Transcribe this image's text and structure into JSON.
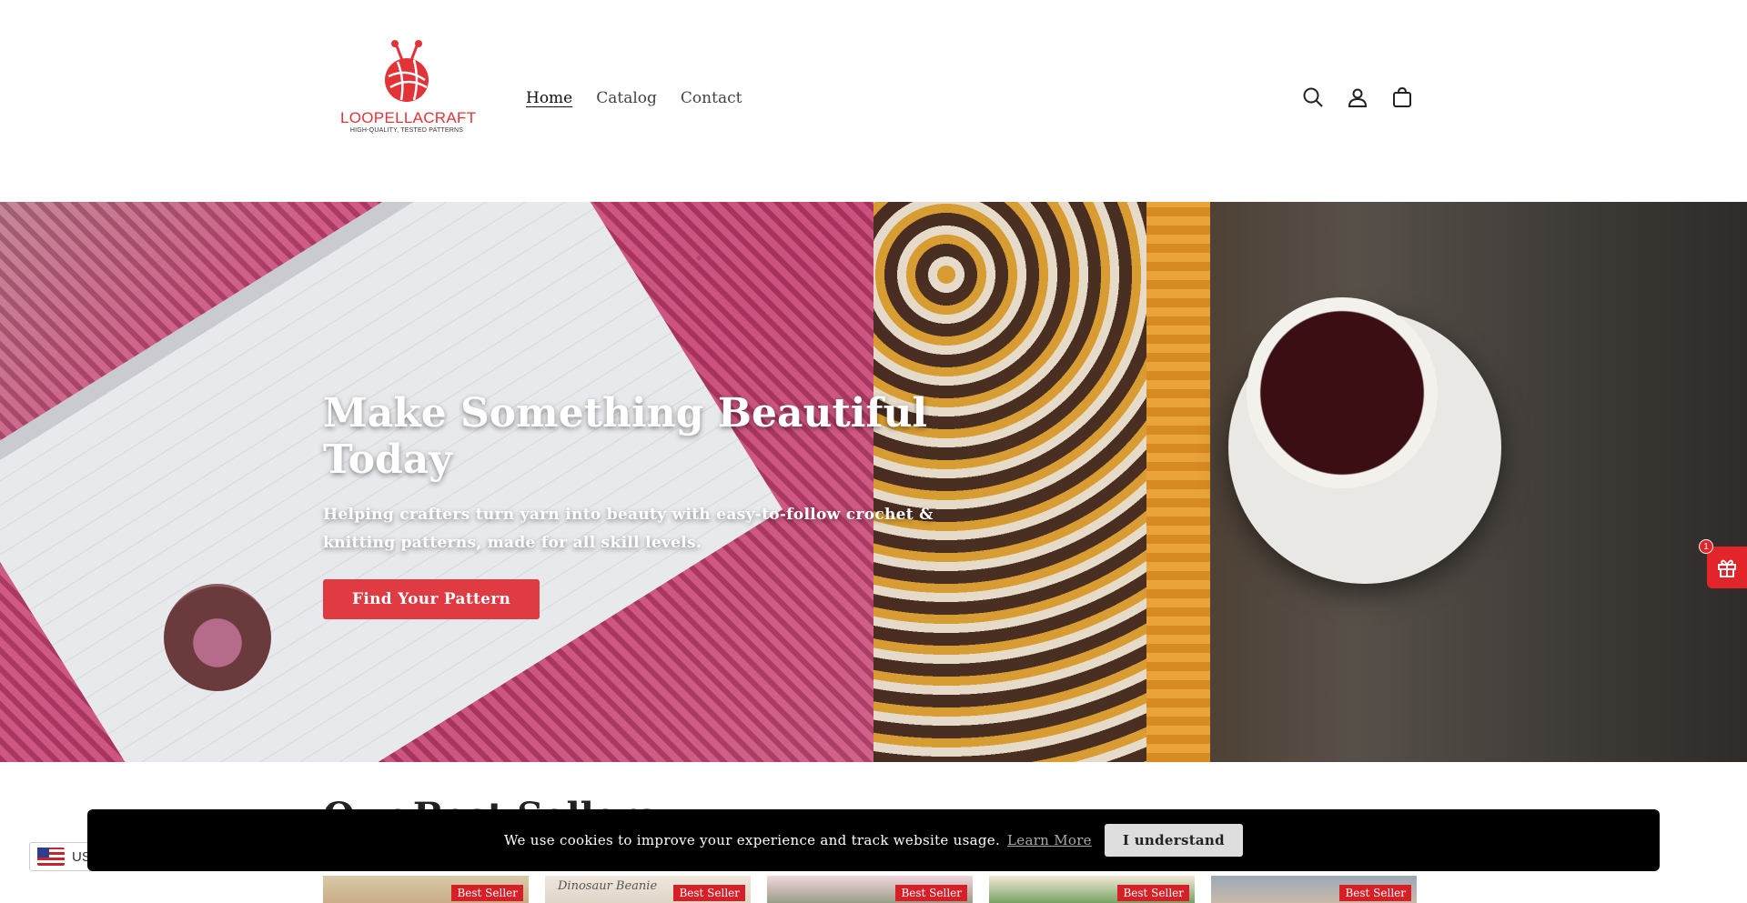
{
  "brand": {
    "name": "LOOPELLACRAFT",
    "tagline": "HIGH-QUALITY, TESTED PATTERNS",
    "accent_color": "#e23337"
  },
  "nav": {
    "items": [
      {
        "label": "Home",
        "active": true
      },
      {
        "label": "Catalog",
        "active": false
      },
      {
        "label": "Contact",
        "active": false
      }
    ]
  },
  "header_icons": [
    "search-icon",
    "account-icon",
    "cart-icon"
  ],
  "hero": {
    "title": "Make Something Beautiful Today",
    "subtitle": "Helping crafters turn yarn into beauty with easy-to-follow crochet & knitting patterns, made for all skill levels.",
    "button_label": "Find Your Pattern",
    "button_color": "#e03a42"
  },
  "best_sellers": {
    "title": "Our Best Sellers",
    "products": [
      {
        "badge": "Best Seller",
        "label": ""
      },
      {
        "badge": "Best Seller",
        "label": "Dinosaur Beanie"
      },
      {
        "badge": "Best Seller",
        "label": ""
      },
      {
        "badge": "Best Seller",
        "label": ""
      },
      {
        "badge": "Best Seller",
        "label": ""
      }
    ]
  },
  "cookie_banner": {
    "message": "We use cookies to improve your experience and track website usage.",
    "link_label": "Learn More",
    "button_label": "I understand"
  },
  "currency": {
    "code": "US"
  },
  "gift_widget": {
    "count": "1",
    "icon": "gift-icon",
    "color": "#e3242b"
  }
}
